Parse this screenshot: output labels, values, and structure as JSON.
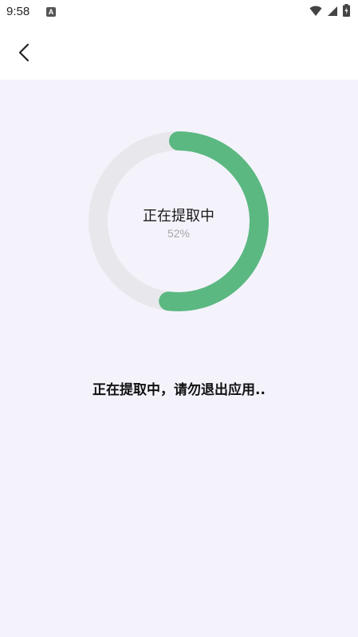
{
  "status_bar": {
    "time": "9:58",
    "icons": [
      "app-notification-icon",
      "wifi-icon",
      "signal-icon",
      "battery-charging-icon"
    ]
  },
  "app_bar": {
    "back_icon": "back-arrow-icon"
  },
  "progress": {
    "title": "正在提取中",
    "percent_label": "52%",
    "value": 0.52,
    "track_color": "#e8e8ec",
    "fill_color": "#5bb881"
  },
  "message": "正在提取中，请勿退出应用..",
  "colors": {
    "background": "#f4f3fc"
  }
}
